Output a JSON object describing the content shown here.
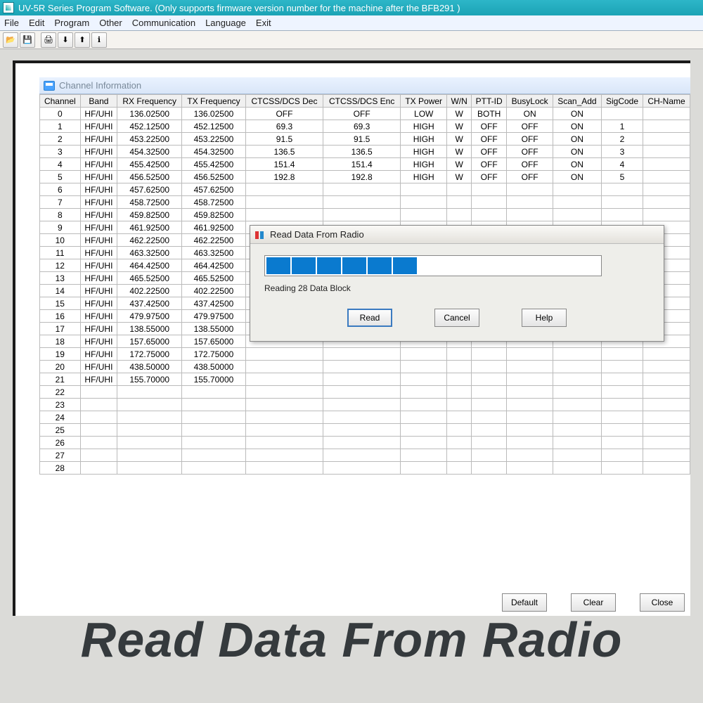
{
  "titlebar": {
    "title": "UV-5R Series Program Software. (Only supports firmware version number for the machine after the BFB291 )"
  },
  "menubar": {
    "items": [
      "File",
      "Edit",
      "Program",
      "Other",
      "Communication",
      "Language",
      "Exit"
    ]
  },
  "toolbar": {
    "icons": [
      "open-icon",
      "save-icon",
      "print-icon",
      "read-icon",
      "write-icon",
      "info-icon"
    ]
  },
  "childWindow": {
    "title": "Channel Information",
    "columns": [
      "Channel",
      "Band",
      "RX Frequency",
      "TX Frequency",
      "CTCSS/DCS Dec",
      "CTCSS/DCS Enc",
      "TX Power",
      "W/N",
      "PTT-ID",
      "BusyLock",
      "Scan_Add",
      "SigCode",
      "CH-Name"
    ],
    "rows": [
      {
        "ch": "0",
        "band": "HF/UHI",
        "rx": "136.02500",
        "tx": "136.02500",
        "dec": "OFF",
        "enc": "OFF",
        "pwr": "LOW",
        "wn": "W",
        "ptt": "BOTH",
        "busy": "ON",
        "scan": "ON",
        "sig": "",
        "name": ""
      },
      {
        "ch": "1",
        "band": "HF/UHI",
        "rx": "452.12500",
        "tx": "452.12500",
        "dec": "69.3",
        "enc": "69.3",
        "pwr": "HIGH",
        "wn": "W",
        "ptt": "OFF",
        "busy": "OFF",
        "scan": "ON",
        "sig": "1",
        "name": ""
      },
      {
        "ch": "2",
        "band": "HF/UHI",
        "rx": "453.22500",
        "tx": "453.22500",
        "dec": "91.5",
        "enc": "91.5",
        "pwr": "HIGH",
        "wn": "W",
        "ptt": "OFF",
        "busy": "OFF",
        "scan": "ON",
        "sig": "2",
        "name": ""
      },
      {
        "ch": "3",
        "band": "HF/UHI",
        "rx": "454.32500",
        "tx": "454.32500",
        "dec": "136.5",
        "enc": "136.5",
        "pwr": "HIGH",
        "wn": "W",
        "ptt": "OFF",
        "busy": "OFF",
        "scan": "ON",
        "sig": "3",
        "name": ""
      },
      {
        "ch": "4",
        "band": "HF/UHI",
        "rx": "455.42500",
        "tx": "455.42500",
        "dec": "151.4",
        "enc": "151.4",
        "pwr": "HIGH",
        "wn": "W",
        "ptt": "OFF",
        "busy": "OFF",
        "scan": "ON",
        "sig": "4",
        "name": ""
      },
      {
        "ch": "5",
        "band": "HF/UHI",
        "rx": "456.52500",
        "tx": "456.52500",
        "dec": "192.8",
        "enc": "192.8",
        "pwr": "HIGH",
        "wn": "W",
        "ptt": "OFF",
        "busy": "OFF",
        "scan": "ON",
        "sig": "5",
        "name": ""
      },
      {
        "ch": "6",
        "band": "HF/UHI",
        "rx": "457.62500",
        "tx": "457.62500",
        "dec": "",
        "enc": "",
        "pwr": "",
        "wn": "",
        "ptt": "",
        "busy": "",
        "scan": "",
        "sig": "",
        "name": ""
      },
      {
        "ch": "7",
        "band": "HF/UHI",
        "rx": "458.72500",
        "tx": "458.72500",
        "dec": "",
        "enc": "",
        "pwr": "",
        "wn": "",
        "ptt": "",
        "busy": "",
        "scan": "",
        "sig": "",
        "name": ""
      },
      {
        "ch": "8",
        "band": "HF/UHI",
        "rx": "459.82500",
        "tx": "459.82500",
        "dec": "",
        "enc": "",
        "pwr": "",
        "wn": "",
        "ptt": "",
        "busy": "",
        "scan": "",
        "sig": "",
        "name": ""
      },
      {
        "ch": "9",
        "band": "HF/UHI",
        "rx": "461.92500",
        "tx": "461.92500",
        "dec": "",
        "enc": "",
        "pwr": "",
        "wn": "",
        "ptt": "",
        "busy": "",
        "scan": "",
        "sig": "",
        "name": ""
      },
      {
        "ch": "10",
        "band": "HF/UHI",
        "rx": "462.22500",
        "tx": "462.22500",
        "dec": "",
        "enc": "",
        "pwr": "",
        "wn": "",
        "ptt": "",
        "busy": "",
        "scan": "",
        "sig": "",
        "name": ""
      },
      {
        "ch": "11",
        "band": "HF/UHI",
        "rx": "463.32500",
        "tx": "463.32500",
        "dec": "",
        "enc": "",
        "pwr": "",
        "wn": "",
        "ptt": "",
        "busy": "",
        "scan": "",
        "sig": "",
        "name": ""
      },
      {
        "ch": "12",
        "band": "HF/UHI",
        "rx": "464.42500",
        "tx": "464.42500",
        "dec": "",
        "enc": "",
        "pwr": "",
        "wn": "",
        "ptt": "",
        "busy": "",
        "scan": "",
        "sig": "",
        "name": ""
      },
      {
        "ch": "13",
        "band": "HF/UHI",
        "rx": "465.52500",
        "tx": "465.52500",
        "dec": "",
        "enc": "",
        "pwr": "",
        "wn": "",
        "ptt": "",
        "busy": "",
        "scan": "",
        "sig": "",
        "name": ""
      },
      {
        "ch": "14",
        "band": "HF/UHI",
        "rx": "402.22500",
        "tx": "402.22500",
        "dec": "",
        "enc": "",
        "pwr": "",
        "wn": "",
        "ptt": "",
        "busy": "",
        "scan": "",
        "sig": "",
        "name": ""
      },
      {
        "ch": "15",
        "band": "HF/UHI",
        "rx": "437.42500",
        "tx": "437.42500",
        "dec": "",
        "enc": "",
        "pwr": "",
        "wn": "",
        "ptt": "",
        "busy": "",
        "scan": "",
        "sig": "",
        "name": ""
      },
      {
        "ch": "16",
        "band": "HF/UHI",
        "rx": "479.97500",
        "tx": "479.97500",
        "dec": "",
        "enc": "",
        "pwr": "",
        "wn": "",
        "ptt": "",
        "busy": "",
        "scan": "",
        "sig": "",
        "name": ""
      },
      {
        "ch": "17",
        "band": "HF/UHI",
        "rx": "138.55000",
        "tx": "138.55000",
        "dec": "",
        "enc": "",
        "pwr": "",
        "wn": "",
        "ptt": "",
        "busy": "",
        "scan": "",
        "sig": "",
        "name": ""
      },
      {
        "ch": "18",
        "band": "HF/UHI",
        "rx": "157.65000",
        "tx": "157.65000",
        "dec": "",
        "enc": "",
        "pwr": "",
        "wn": "",
        "ptt": "",
        "busy": "",
        "scan": "",
        "sig": "",
        "name": ""
      },
      {
        "ch": "19",
        "band": "HF/UHI",
        "rx": "172.75000",
        "tx": "172.75000",
        "dec": "",
        "enc": "",
        "pwr": "",
        "wn": "",
        "ptt": "",
        "busy": "",
        "scan": "",
        "sig": "",
        "name": ""
      },
      {
        "ch": "20",
        "band": "HF/UHI",
        "rx": "438.50000",
        "tx": "438.50000",
        "dec": "",
        "enc": "",
        "pwr": "",
        "wn": "",
        "ptt": "",
        "busy": "",
        "scan": "",
        "sig": "",
        "name": ""
      },
      {
        "ch": "21",
        "band": "HF/UHI",
        "rx": "155.70000",
        "tx": "155.70000",
        "dec": "",
        "enc": "",
        "pwr": "",
        "wn": "",
        "ptt": "",
        "busy": "",
        "scan": "",
        "sig": "",
        "name": ""
      },
      {
        "ch": "22",
        "band": "",
        "rx": "",
        "tx": "",
        "dec": "",
        "enc": "",
        "pwr": "",
        "wn": "",
        "ptt": "",
        "busy": "",
        "scan": "",
        "sig": "",
        "name": ""
      },
      {
        "ch": "23",
        "band": "",
        "rx": "",
        "tx": "",
        "dec": "",
        "enc": "",
        "pwr": "",
        "wn": "",
        "ptt": "",
        "busy": "",
        "scan": "",
        "sig": "",
        "name": ""
      },
      {
        "ch": "24",
        "band": "",
        "rx": "",
        "tx": "",
        "dec": "",
        "enc": "",
        "pwr": "",
        "wn": "",
        "ptt": "",
        "busy": "",
        "scan": "",
        "sig": "",
        "name": ""
      },
      {
        "ch": "25",
        "band": "",
        "rx": "",
        "tx": "",
        "dec": "",
        "enc": "",
        "pwr": "",
        "wn": "",
        "ptt": "",
        "busy": "",
        "scan": "",
        "sig": "",
        "name": ""
      },
      {
        "ch": "26",
        "band": "",
        "rx": "",
        "tx": "",
        "dec": "",
        "enc": "",
        "pwr": "",
        "wn": "",
        "ptt": "",
        "busy": "",
        "scan": "",
        "sig": "",
        "name": ""
      },
      {
        "ch": "27",
        "band": "",
        "rx": "",
        "tx": "",
        "dec": "",
        "enc": "",
        "pwr": "",
        "wn": "",
        "ptt": "",
        "busy": "",
        "scan": "",
        "sig": "",
        "name": ""
      },
      {
        "ch": "28",
        "band": "",
        "rx": "",
        "tx": "",
        "dec": "",
        "enc": "",
        "pwr": "",
        "wn": "",
        "ptt": "",
        "busy": "",
        "scan": "",
        "sig": "",
        "name": ""
      }
    ]
  },
  "dialog": {
    "title": "Read Data From Radio",
    "progressSegments": 6,
    "status": "Reading 28 Data Block",
    "buttons": {
      "read": "Read",
      "cancel": "Cancel",
      "help": "Help"
    }
  },
  "bottomButtons": {
    "default": "Default",
    "clear": "Clear",
    "close": "Close"
  },
  "caption": "Read Data From Radio"
}
